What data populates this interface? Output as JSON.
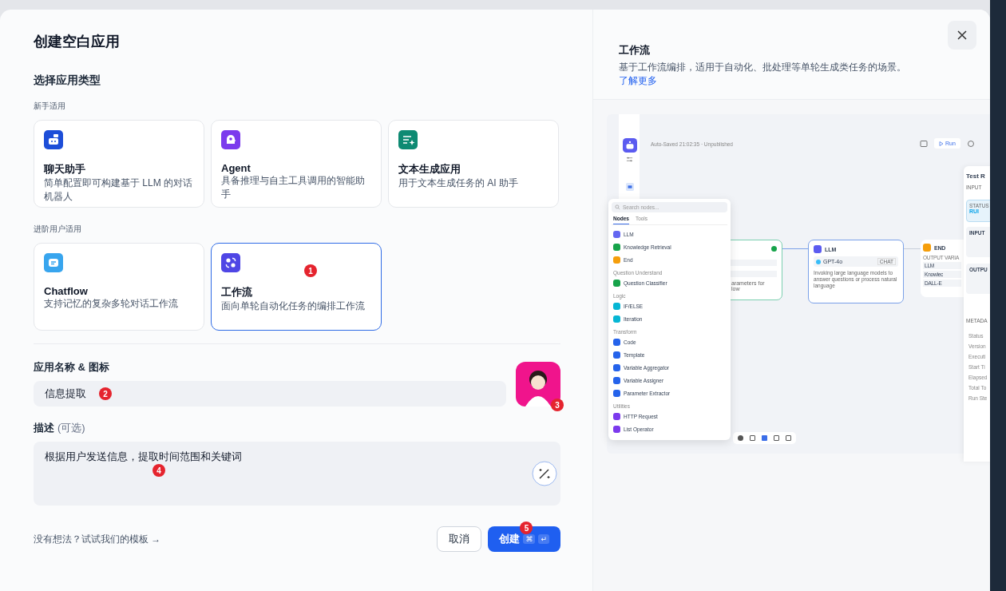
{
  "dialog": {
    "title": "创建空白应用",
    "section_title": "选择应用类型"
  },
  "groups": [
    {
      "label": "新手适用",
      "types": [
        {
          "kind": "chat",
          "name": "聊天助手",
          "description": "简单配置即可构建基于 LLM 的对话机器人",
          "selected": false
        },
        {
          "kind": "agent",
          "name": "Agent",
          "description": "具备推理与自主工具调用的智能助手",
          "selected": false
        },
        {
          "kind": "text",
          "name": "文本生成应用",
          "description": "用于文本生成任务的 AI 助手",
          "selected": false
        }
      ]
    },
    {
      "label": "进阶用户适用",
      "types": [
        {
          "kind": "chatflow",
          "name": "Chatflow",
          "description": "支持记忆的复杂多轮对话工作流",
          "selected": false
        },
        {
          "kind": "workflow",
          "name": "工作流",
          "description": "面向单轮自动化任务的编排工作流",
          "selected": true,
          "marker": "1"
        }
      ]
    }
  ],
  "name_field": {
    "label": "应用名称 & 图标",
    "value": "信息提取",
    "marker": "2",
    "avatar_marker": "3"
  },
  "description_field": {
    "label": "描述",
    "hint": "(可选)",
    "value": "根据用户发送信息，提取时间范围和关键词",
    "marker": "4"
  },
  "template_link": "没有想法？试试我们的模板 →",
  "buttons": {
    "cancel": "取消",
    "create": "创建",
    "shortcut": [
      "⌘",
      "↵"
    ],
    "create_marker": "5"
  },
  "preview": {
    "title": "工作流",
    "description": "基于工作流编排，适用于自动化、批处理等单轮生成类任务的场景。",
    "link": "了解更多",
    "screenshot": {
      "status": "Auto-Saved 21:02:35 · Unpublished",
      "run": "Run",
      "search_placeholder": "Search nodes...",
      "tabs": [
        {
          "label": "Nodes",
          "selected": true
        },
        {
          "label": "Tools",
          "selected": false
        }
      ],
      "sections": [
        {
          "items": [
            {
              "label": "LLM",
              "color": "#6366f1"
            },
            {
              "label": "Knowledge Retrieval",
              "color": "#16a34a"
            },
            {
              "label": "End",
              "color": "#f59e0b"
            }
          ]
        },
        {
          "title": "Question Understand",
          "items": [
            {
              "label": "Question Classifier",
              "color": "#16a34a"
            }
          ]
        },
        {
          "title": "Logic",
          "items": [
            {
              "label": "IF/ELSE",
              "color": "#06b6d4"
            },
            {
              "label": "Iteration",
              "color": "#06b6d4"
            }
          ]
        },
        {
          "title": "Transform",
          "items": [
            {
              "label": "Code",
              "color": "#2563eb"
            },
            {
              "label": "Template",
              "color": "#2563eb"
            },
            {
              "label": "Variable Aggregator",
              "color": "#2563eb"
            },
            {
              "label": "Variable Assigner",
              "color": "#2563eb"
            },
            {
              "label": "Parameter Extractor",
              "color": "#2563eb"
            }
          ]
        },
        {
          "title": "Utilities",
          "items": [
            {
              "label": "HTTP Request",
              "color": "#7c3aed"
            },
            {
              "label": "List Operator",
              "color": "#7c3aed"
            }
          ]
        }
      ],
      "start_node": {
        "description": [
          "arameters for",
          "low"
        ]
      },
      "llm_node": {
        "title": "LLM",
        "model": "GPT-4o",
        "tag": "CHAT",
        "description": "Invoking large language models to answer questions or process natural language"
      },
      "end_node": {
        "title": "END",
        "caption": "OUTPUT VARIA",
        "outputs": [
          "LLM",
          "Knowlec",
          "DALL-E"
        ]
      },
      "test_run": {
        "title": "Test R",
        "input": "INPUT",
        "status_label": "STATUS",
        "status": "RUI",
        "sections": [
          "INPUT",
          "OUTPU"
        ],
        "metadata": "METADA",
        "rows": [
          "Status",
          "Version",
          "Executi",
          "Start Ti",
          "Elapsed",
          "Total To",
          "Run Ste"
        ]
      }
    }
  }
}
